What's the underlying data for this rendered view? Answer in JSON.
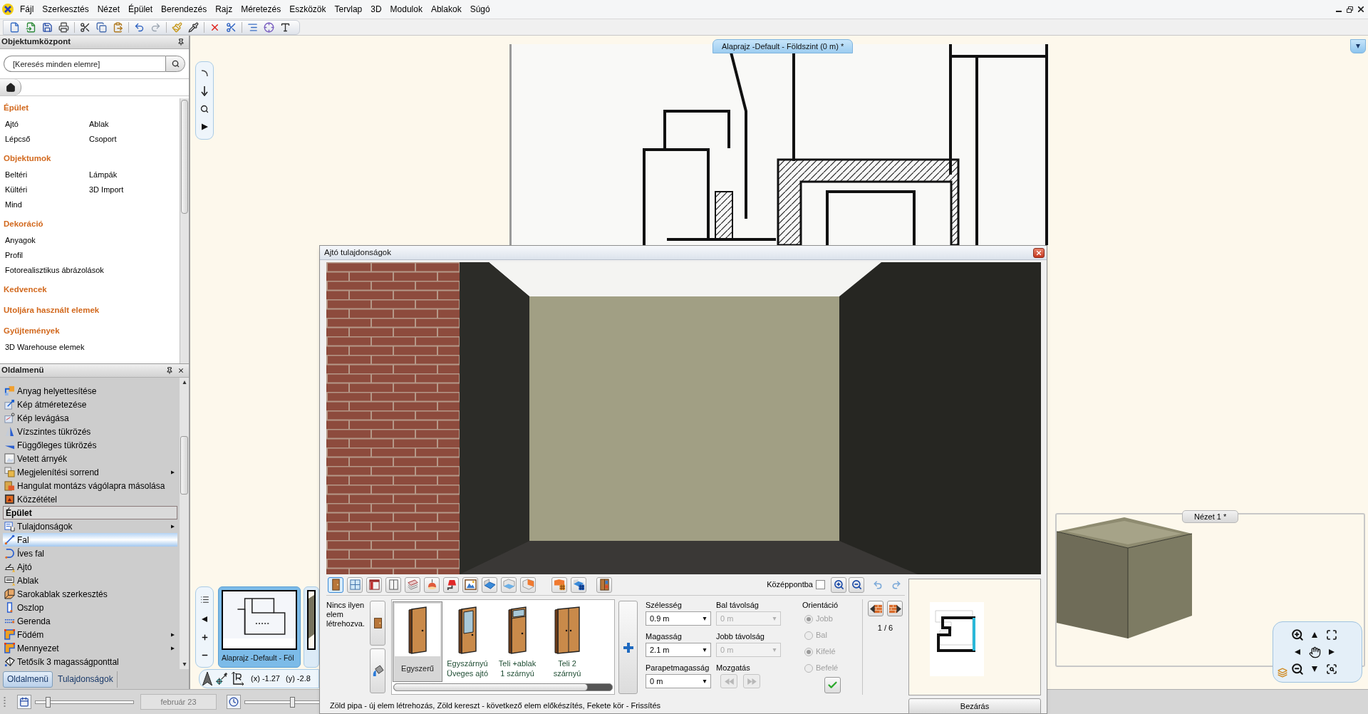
{
  "menu": [
    "Fájl",
    "Szerkesztés",
    "Nézet",
    "Épület",
    "Berendezés",
    "Rajz",
    "Méretezés",
    "Eszközök",
    "Tervlap",
    "3D",
    "Modulok",
    "Ablakok",
    "Súgó"
  ],
  "object_center": {
    "title": "Objektumközpont",
    "search": {
      "placeholder": "[Keresés minden elemre]"
    },
    "sections": [
      {
        "title": "Épület",
        "rows": [
          [
            "Ajtó",
            "Ablak"
          ],
          [
            "Lépcső",
            "Csoport"
          ]
        ]
      },
      {
        "title": "Objektumok",
        "rows": [
          [
            "Beltéri",
            "Lámpák"
          ],
          [
            "Kültéri",
            "3D Import"
          ],
          [
            "Mind"
          ]
        ]
      },
      {
        "title": "Dekoráció",
        "rows": [
          [
            "Anyagok"
          ],
          [
            "Profil"
          ],
          [
            "Fotorealisztikus ábrázolások"
          ]
        ]
      },
      {
        "title": "Kedvencek"
      },
      {
        "title": "Utoljára használt elemek"
      },
      {
        "title": "Gyűjtemények",
        "rows": [
          [
            "3D Warehouse elemek"
          ]
        ]
      }
    ]
  },
  "side_menu": {
    "title": "Oldalmenü",
    "items": [
      {
        "kind": "item",
        "label": "Anyag helyettesítése",
        "submenu": false,
        "selected": false
      },
      {
        "kind": "item",
        "label": "Kép átméretezése",
        "submenu": false,
        "selected": false
      },
      {
        "kind": "item",
        "label": "Kép levágása",
        "submenu": false,
        "selected": false
      },
      {
        "kind": "item",
        "label": "Vízszintes tükrözés",
        "submenu": false,
        "selected": false
      },
      {
        "kind": "item",
        "label": "Függőleges tükrözés",
        "submenu": false,
        "selected": false
      },
      {
        "kind": "item",
        "label": "Vetett árnyék",
        "submenu": false,
        "selected": false
      },
      {
        "kind": "item",
        "label": "Megjelenítési sorrend",
        "submenu": true,
        "selected": false
      },
      {
        "kind": "item",
        "label": "Hangulat montázs vágólapra másolása",
        "submenu": false,
        "selected": false
      },
      {
        "kind": "item",
        "label": "Közzététel",
        "submenu": false,
        "selected": false
      },
      {
        "kind": "header",
        "label": "Épület"
      },
      {
        "kind": "item",
        "label": "Tulajdonságok",
        "submenu": true,
        "selected": false
      },
      {
        "kind": "item",
        "label": "Fal",
        "submenu": false,
        "selected": true
      },
      {
        "kind": "item",
        "label": "Íves fal",
        "submenu": false,
        "selected": false
      },
      {
        "kind": "item",
        "label": "Ajtó",
        "submenu": false,
        "selected": false
      },
      {
        "kind": "item",
        "label": "Ablak",
        "submenu": false,
        "selected": false
      },
      {
        "kind": "item",
        "label": "Sarokablak szerkesztés",
        "submenu": false,
        "selected": false
      },
      {
        "kind": "item",
        "label": "Oszlop",
        "submenu": false,
        "selected": false
      },
      {
        "kind": "item",
        "label": "Gerenda",
        "submenu": false,
        "selected": false
      },
      {
        "kind": "item",
        "label": "Födém",
        "submenu": true,
        "selected": false
      },
      {
        "kind": "item",
        "label": "Mennyezet",
        "submenu": true,
        "selected": false
      },
      {
        "kind": "item",
        "label": "Tetősík 3 magasságponttal",
        "submenu": false,
        "selected": false
      }
    ]
  },
  "panel_tabs": [
    {
      "label": "Oldalmenü",
      "selected": true
    },
    {
      "label": "Tulajdonságok",
      "selected": false
    }
  ],
  "status_bar": {
    "zoom_slider": {
      "level": 0.13
    },
    "date": "február 23",
    "time_slider": {
      "level": 0.62
    }
  },
  "plan_view": {
    "tab": "Alaprajz -Default - Földszint (0 m) *",
    "thumbnails": [
      {
        "kind": "plan",
        "caption": "Alaprajz -Default - Föl",
        "selected": true
      },
      {
        "kind": "view",
        "selected": false
      }
    ],
    "coordinates": [
      "(x) -1.27",
      "(y) -2.8"
    ]
  },
  "view_3d": {
    "tab": "Nézet 1 *"
  },
  "door_dialog": {
    "title": "Ajtó tulajdonságok",
    "categories": [
      {
        "selected": true
      },
      {
        "selected": false
      },
      {
        "selected": false
      },
      {
        "selected": false
      },
      {
        "selected": false
      },
      {
        "selected": false
      },
      {
        "selected": false
      },
      {
        "selected": false
      },
      {
        "selected": false
      },
      {
        "selected": false
      },
      {
        "selected": false
      },
      {
        "selected": false
      },
      {
        "selected": false
      },
      {
        "selected": false
      }
    ],
    "center_option": {
      "label": "Középpontba",
      "checked": false
    },
    "empty_note": "Nincs ilyen elem létrehozva.",
    "gallery": [
      {
        "kind": "single",
        "caption": "Egyszerű",
        "selected": true
      },
      {
        "kind": "glazed",
        "caption": "Egyszárnyú\nÜveges ajtó",
        "selected": false
      },
      {
        "kind": "transom",
        "caption": "Teli +ablak\n1 szárnyú",
        "selected": false
      },
      {
        "kind": "double",
        "caption": "Teli 2\nszárnyú",
        "selected": false
      }
    ],
    "size_fields": [
      {
        "label": "Szélesség",
        "value": "0.9 m",
        "disabled": false
      },
      {
        "label": "Magasság",
        "value": "2.1 m",
        "disabled": false
      },
      {
        "label": "Parapetmagasság",
        "value": "0 m",
        "disabled": false
      }
    ],
    "offset_fields": [
      {
        "label": "Bal távolság",
        "value": "0 m",
        "disabled": true
      },
      {
        "label": "Jobb távolság",
        "value": "0 m",
        "disabled": true
      }
    ],
    "move": {
      "label": "Mozgatás",
      "disabled": true
    },
    "orientation": {
      "label": "Orientáció",
      "groups": [
        [
          {
            "label": "Jobb",
            "selected": true,
            "disabled": true
          },
          {
            "label": "Bal",
            "selected": false,
            "disabled": true
          }
        ],
        [
          {
            "label": "Kifelé",
            "selected": true,
            "disabled": true
          },
          {
            "label": "Befelé",
            "selected": false,
            "disabled": true
          }
        ]
      ]
    },
    "page": "1 / 6",
    "close_button": "Bezárás",
    "hint": "Zöld pipa - új elem létrehozás, Zöld kereszt - következő elem előkészítés, Fekete kör - Frissítés"
  }
}
